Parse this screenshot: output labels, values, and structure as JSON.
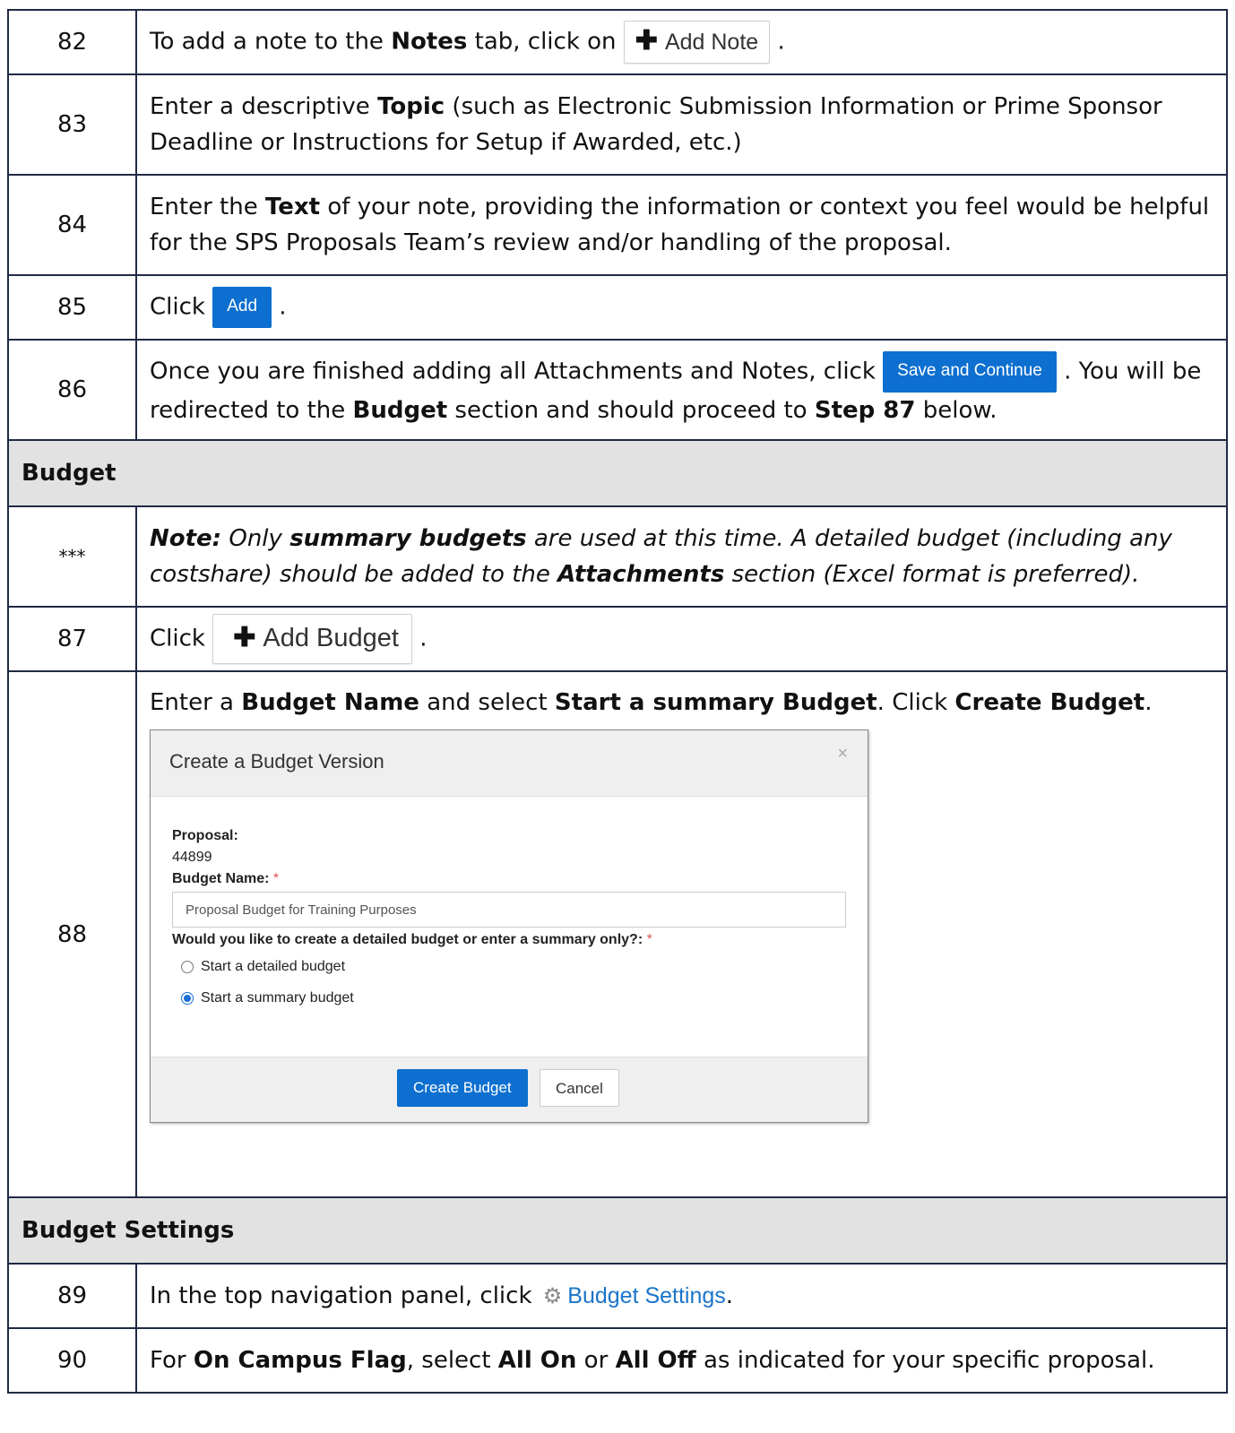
{
  "rows": {
    "r82": {
      "num": "82",
      "t1": "To add a note to the ",
      "b1": "Notes",
      "t2": " tab, click on ",
      "btn": "Add Note",
      "t3": "."
    },
    "r83": {
      "num": "83",
      "t1": "Enter a descriptive ",
      "b1": "Topic",
      "t2": " (such as Electronic Submission Information or Prime Sponsor Deadline or Instructions for Setup if Awarded, etc.)"
    },
    "r84": {
      "num": "84",
      "t1": "Enter the ",
      "b1": "Text",
      "t2": " of your note, providing the information or context you feel would be helpful for the SPS Proposals Team’s review and/or handling of the proposal."
    },
    "r85": {
      "num": "85",
      "t1": "Click ",
      "btn": "Add",
      "t2": "."
    },
    "r86": {
      "num": "86",
      "t1": "Once you are finished adding all Attachments and Notes, click ",
      "btn": "Save and Continue",
      "t2": ". You will be redirected to the ",
      "b1": "Budget",
      "t3": " section and should proceed to ",
      "b2": "Step 87",
      "t4": " below."
    },
    "section_budget": "Budget",
    "rnote": {
      "num": "***",
      "b1": "Note:",
      "t1": " Only ",
      "b2": "summary budgets",
      "t2": " are used at this time. A detailed budget (including any costshare) should be added to the ",
      "b3": "Attachments",
      "t3": " section (Excel format is preferred)."
    },
    "r87": {
      "num": "87",
      "t1": "Click ",
      "btn": "Add Budget",
      "t2": "."
    },
    "r88": {
      "num": "88",
      "t1": "Enter a ",
      "b1": "Budget Name",
      "t2": " and select ",
      "b2": "Start a summary Budget",
      "t3": ". Click ",
      "b3": "Create Budget",
      "t4": "."
    },
    "section_settings": "Budget Settings",
    "r89": {
      "num": "89",
      "t1": "In the top navigation panel, click ",
      "link": "Budget Settings",
      "t2": "."
    },
    "r90": {
      "num": "90",
      "t1": "For ",
      "b1": "On Campus Flag",
      "t2": ", select ",
      "b2": "All On",
      "t3": " or ",
      "b3": "All Off",
      "t4": " as indicated for your specific proposal."
    }
  },
  "dialog": {
    "title": "Create a Budget Version",
    "close": "×",
    "proposal_label": "Proposal:",
    "proposal_value": "44899",
    "budget_name_label": "Budget Name:",
    "required_mark": "*",
    "budget_name_value": "Proposal Budget for Training Purposes",
    "question": "Would you like to create a detailed budget or enter a summary only?:",
    "option_detailed": "Start a detailed budget",
    "option_summary": "Start a summary budget",
    "selected_option": "Start a summary budget",
    "create_button": "Create Budget",
    "cancel_button": "Cancel"
  },
  "icons": {
    "plus": "plus-icon",
    "gear": "gear-icon",
    "close": "close-icon"
  },
  "colors": {
    "primary_button": "#0d6fcf",
    "section_bg": "#e2e2e2",
    "link": "#1a74c9",
    "border": "#1f2a44"
  }
}
